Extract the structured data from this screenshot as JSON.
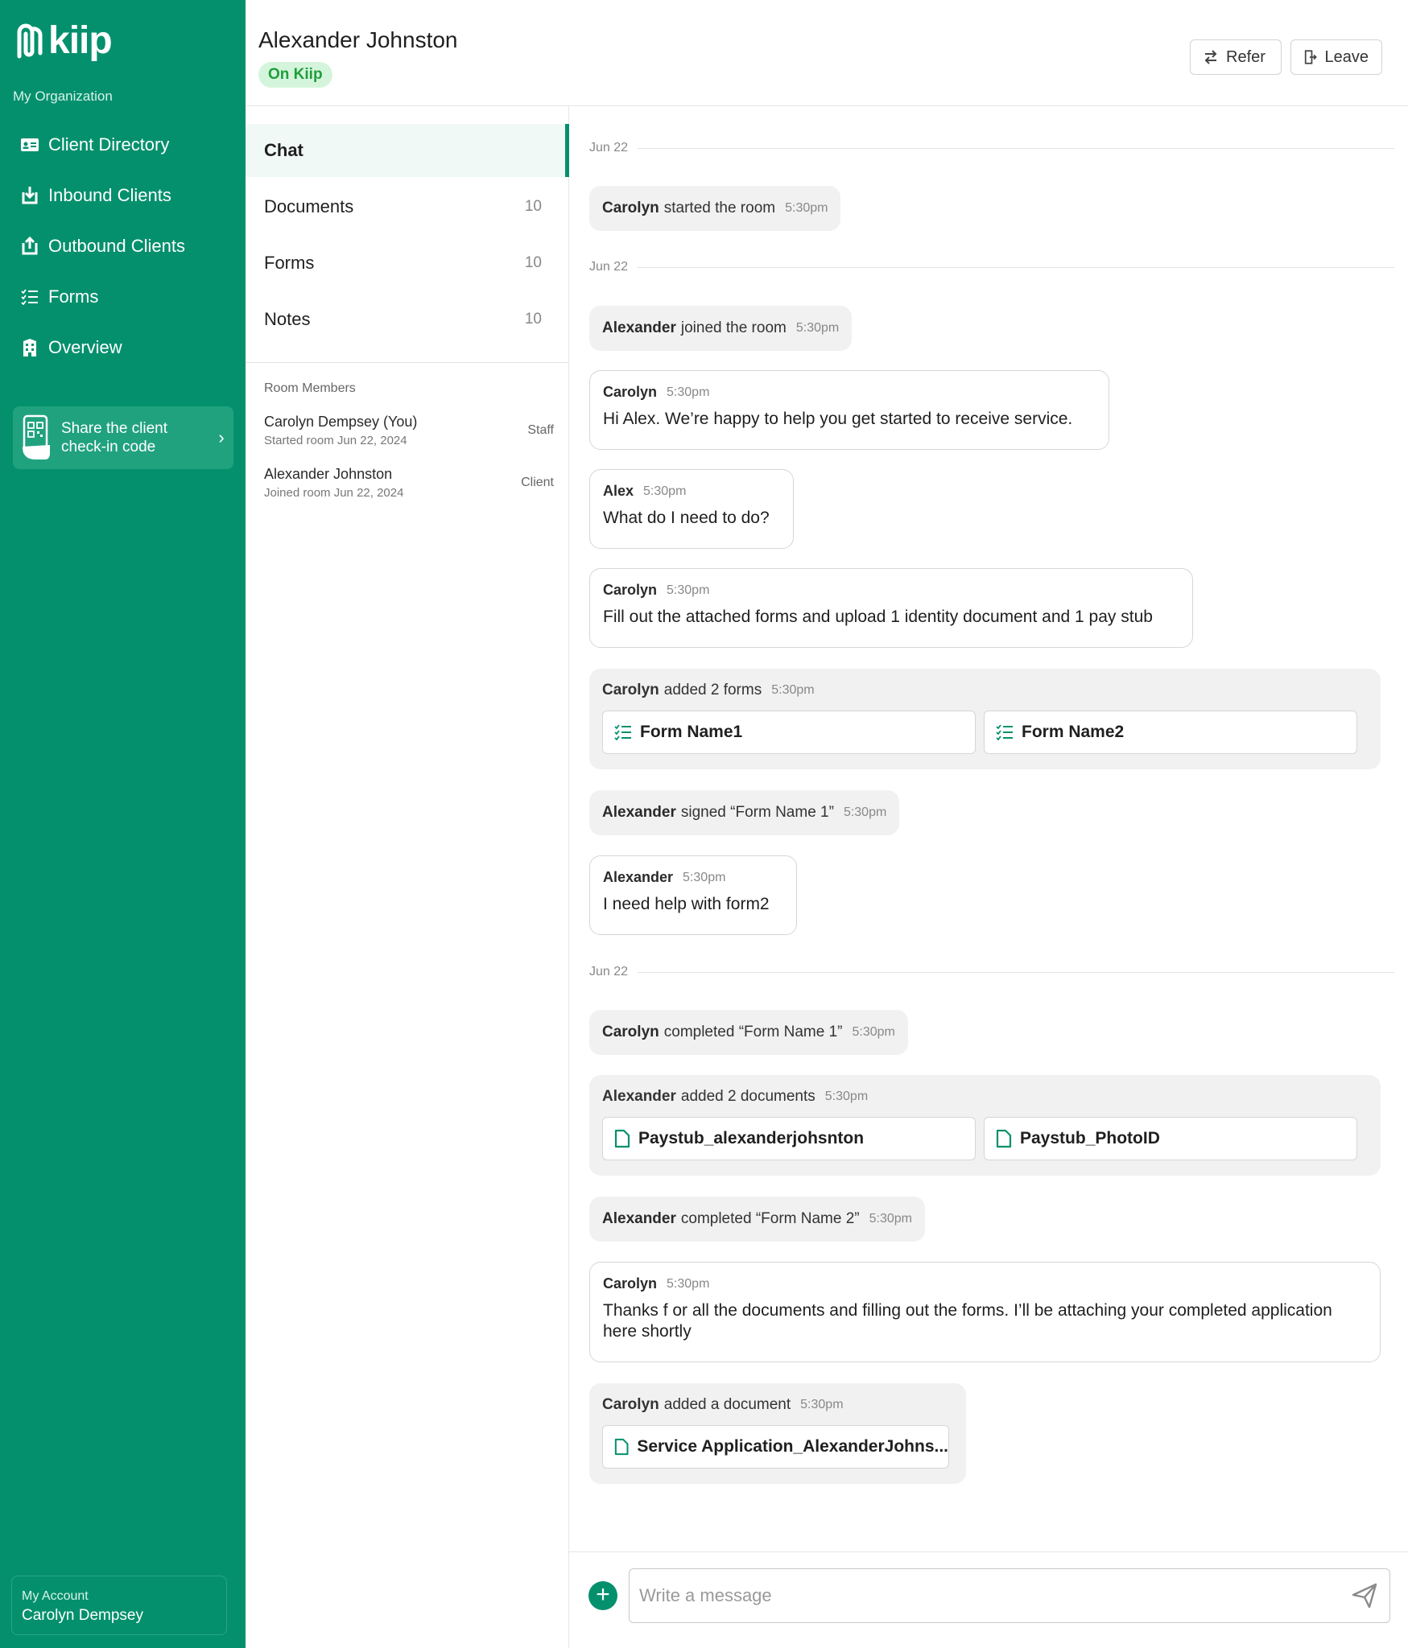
{
  "sidebar": {
    "logo_text": "kiip",
    "org_label": "My Organization",
    "nav": [
      {
        "label": "Client Directory",
        "icon": "id-card-icon"
      },
      {
        "label": "Inbound Clients",
        "icon": "inbound-icon"
      },
      {
        "label": "Outbound Clients",
        "icon": "outbound-icon"
      },
      {
        "label": "Forms",
        "icon": "checklist-icon"
      },
      {
        "label": "Overview",
        "icon": "building-icon"
      }
    ],
    "share_card": {
      "line1": "Share the client",
      "line2": "check-in code"
    },
    "account": {
      "label": "My Account",
      "name": "Carolyn Dempsey"
    }
  },
  "header": {
    "client_name": "Alexander Johnston",
    "status": "On Kiip",
    "refer_label": "Refer",
    "leave_label": "Leave"
  },
  "tabs": [
    {
      "label": "Chat",
      "count": ""
    },
    {
      "label": "Documents",
      "count": "10"
    },
    {
      "label": "Forms",
      "count": "10"
    },
    {
      "label": "Notes",
      "count": "10"
    }
  ],
  "members": {
    "title": "Room Members",
    "list": [
      {
        "name": "Carolyn Dempsey (You)",
        "sub": "Started room Jun 22, 2024",
        "role": "Staff"
      },
      {
        "name": "Alexander Johnston",
        "sub": "Joined room Jun 22, 2024",
        "role": "Client"
      }
    ]
  },
  "chat": {
    "dates": [
      "Jun 22",
      "Jun 22",
      "Jun 22"
    ],
    "sys1": {
      "actor": "Carolyn",
      "text": "started the room",
      "time": "5:30pm"
    },
    "sys2": {
      "actor": "Alexander",
      "text": "joined the room",
      "time": "5:30pm"
    },
    "msg1": {
      "author": "Carolyn",
      "time": "5:30pm",
      "text": "Hi Alex. We’re happy to help you get started to receive service."
    },
    "msg2": {
      "author": "Alex",
      "time": "5:30pm",
      "text": "What do I need to do?"
    },
    "msg3": {
      "author": "Carolyn",
      "time": "5:30pm",
      "text": "Fill out the attached forms and upload 1 identity document and 1 pay stub"
    },
    "forms_group": {
      "actor": "Carolyn",
      "text": "added 2 forms",
      "time": "5:30pm",
      "items": [
        "Form Name1",
        "Form Name2"
      ]
    },
    "sys3": {
      "actor": "Alexander",
      "text": "signed “Form Name 1”",
      "time": "5:30pm"
    },
    "msg4": {
      "author": "Alexander",
      "time": "5:30pm",
      "text": "I need help with form2"
    },
    "sys4": {
      "actor": "Carolyn",
      "text": "completed “Form Name 1”",
      "time": "5:30pm"
    },
    "docs_group": {
      "actor": "Alexander",
      "text": "added 2 documents",
      "time": "5:30pm",
      "items": [
        "Paystub_alexanderjohsnton",
        "Paystub_PhotoID"
      ]
    },
    "sys5": {
      "actor": "Alexander",
      "text": "completed “Form Name 2”",
      "time": "5:30pm"
    },
    "msg5": {
      "author": "Carolyn",
      "time": "5:30pm",
      "text": "Thanks f or all the documents and filling out the forms. I’ll be attaching your completed application here shortly"
    },
    "doc_group": {
      "actor": "Carolyn",
      "text": "added a document",
      "time": "5:30pm",
      "items": [
        "Service Application_AlexanderJohns..."
      ]
    }
  },
  "composer": {
    "placeholder": "Write a message"
  },
  "colors": {
    "brand": "#04906d",
    "badge_bg": "#d4f5dc",
    "badge_text": "#1f9d3a"
  }
}
